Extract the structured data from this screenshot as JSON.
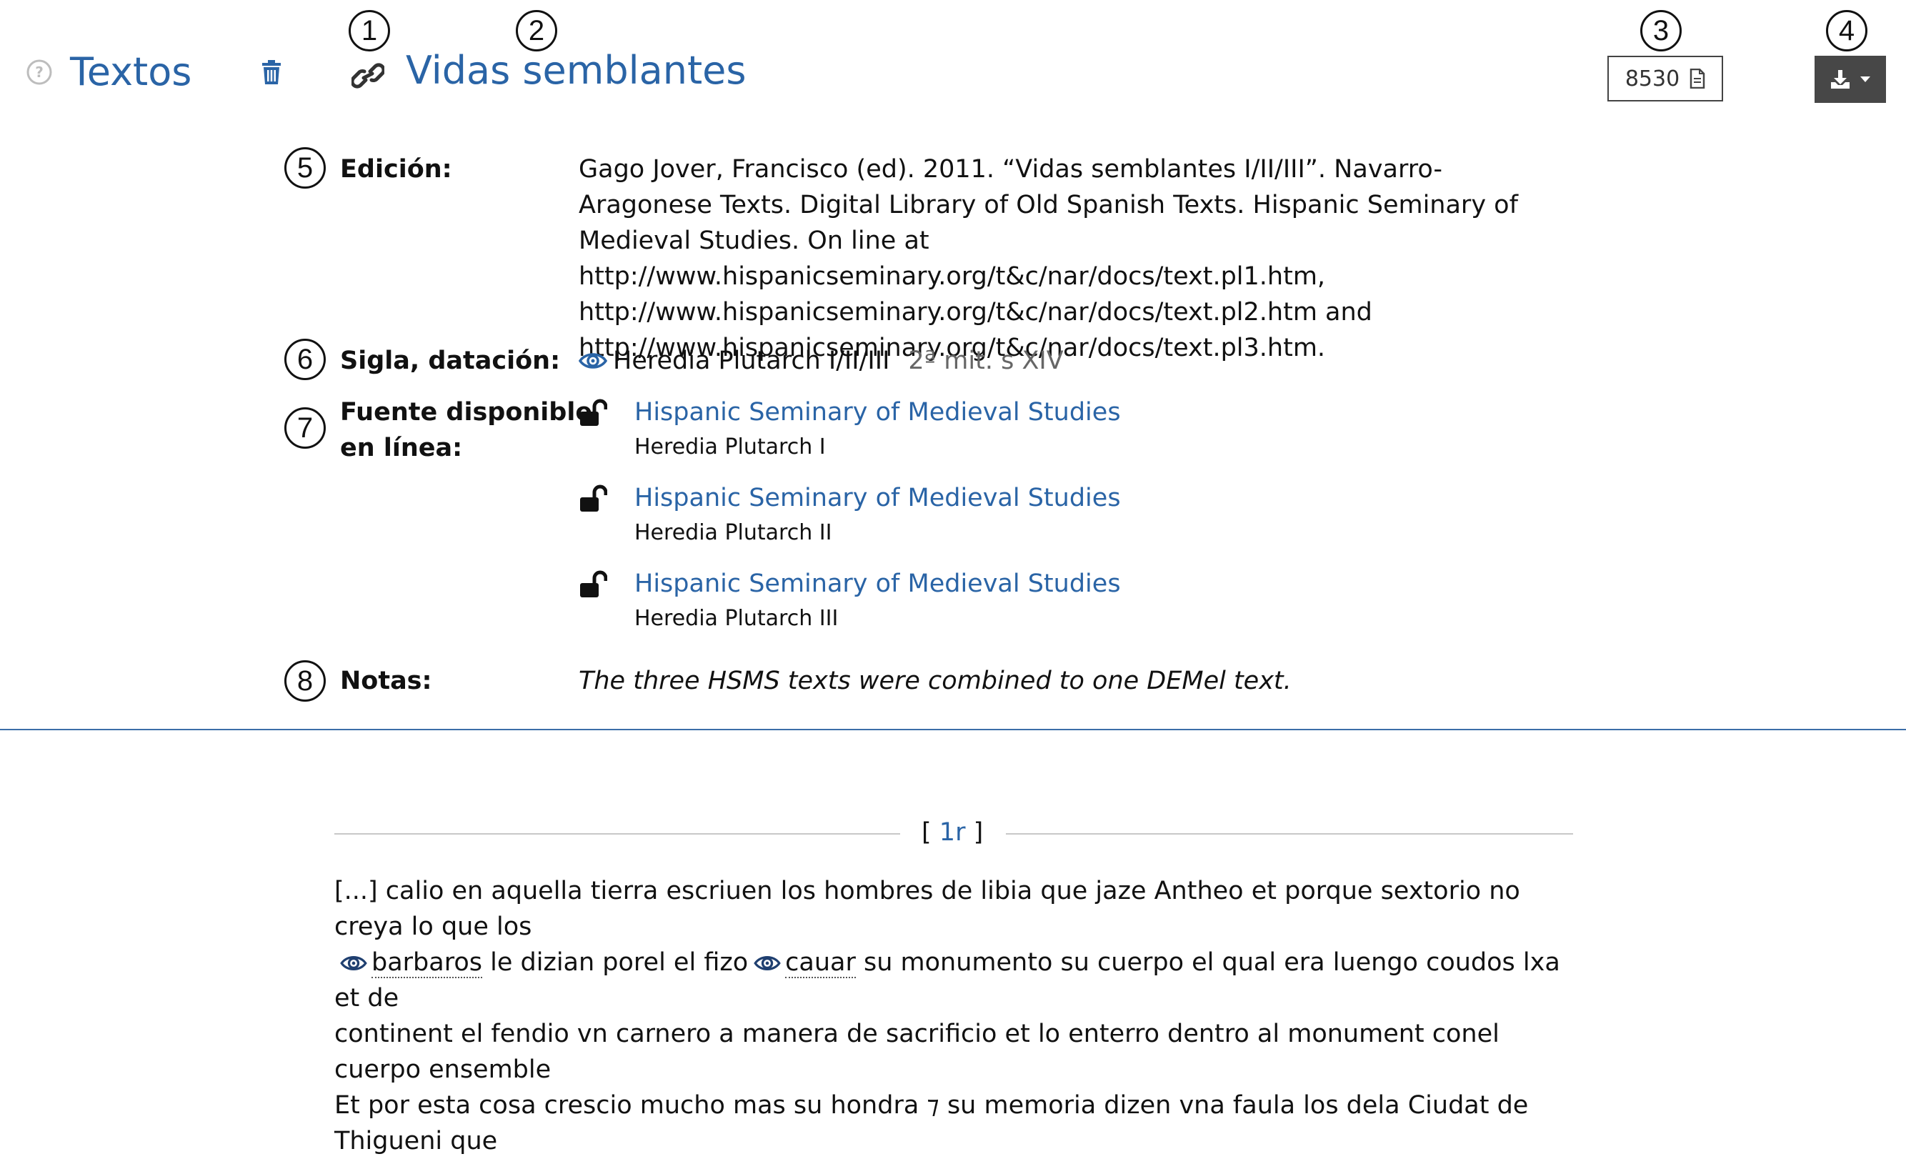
{
  "header": {
    "section_title": "Textos",
    "doc_title": "Vidas semblantes",
    "count": "8530"
  },
  "callouts": [
    "1",
    "2",
    "3",
    "4",
    "5",
    "6",
    "7",
    "8"
  ],
  "meta": {
    "edition_label": "Edición:",
    "edition_value": "Gago Jover, Francisco (ed). 2011. “Vidas semblantes I/II/III”. Navarro-Aragonese Texts. Digital Library of Old Spanish Texts. Hispanic Seminary of Medieval Studies. On line at http://www.hispanicseminary.org/t&c/nar/docs/text.pl1.htm, http://www.hispanicseminary.org/t&c/nar/docs/text.pl2.htm and http://www.hispanicseminary.org/t&c/nar/docs/text.pl3.htm.",
    "sigla_label": "Sigla, datación:",
    "sigla_value": "Heredia Plutarch I/II/III",
    "sigla_date": "2ª mit. s XIV",
    "source_label_line1": "Fuente disponible",
    "source_label_line2": "en línea:",
    "sources": [
      {
        "link": "Hispanic Seminary of Medieval Studies",
        "sub": "Heredia Plutarch I"
      },
      {
        "link": "Hispanic Seminary of Medieval Studies",
        "sub": "Heredia Plutarch II"
      },
      {
        "link": "Hispanic Seminary of Medieval Studies",
        "sub": "Heredia Plutarch III"
      }
    ],
    "notes_label": "Notas:",
    "notes_value": "The three HSMS texts were combined to one DEMel text."
  },
  "folio": {
    "open": "[",
    "link": "1r",
    "close": "]"
  },
  "body": {
    "line1": "[...] calio en aquella tierra escriuen los hombres de libia que jaze Antheo et porque sextorio no creya lo que los",
    "gloss1": "barbaros",
    "seg2": " le dizian porel el fizo",
    "gloss2": "cauar",
    "seg3": " su monumento su cuerpo el qual era luengo coudos lxa et de",
    "line3": "continent el fendio vn carnero a manera de sacrificio et lo enterro dentro al monument conel cuerpo ensemble",
    "line4": "Et por esta cosa crescio mucho mas su hondra ⁊ su memoria dizen vna faula los dela Ciudat de Thigueni que"
  },
  "colors": {
    "accent": "#2a64a6",
    "divider": "#3b6ea8",
    "download_bg": "#474747"
  },
  "icons": [
    "help-icon",
    "trash-icon",
    "link-icon",
    "document-icon",
    "download-icon",
    "caret-down-icon",
    "eye-icon",
    "unlock-icon"
  ]
}
